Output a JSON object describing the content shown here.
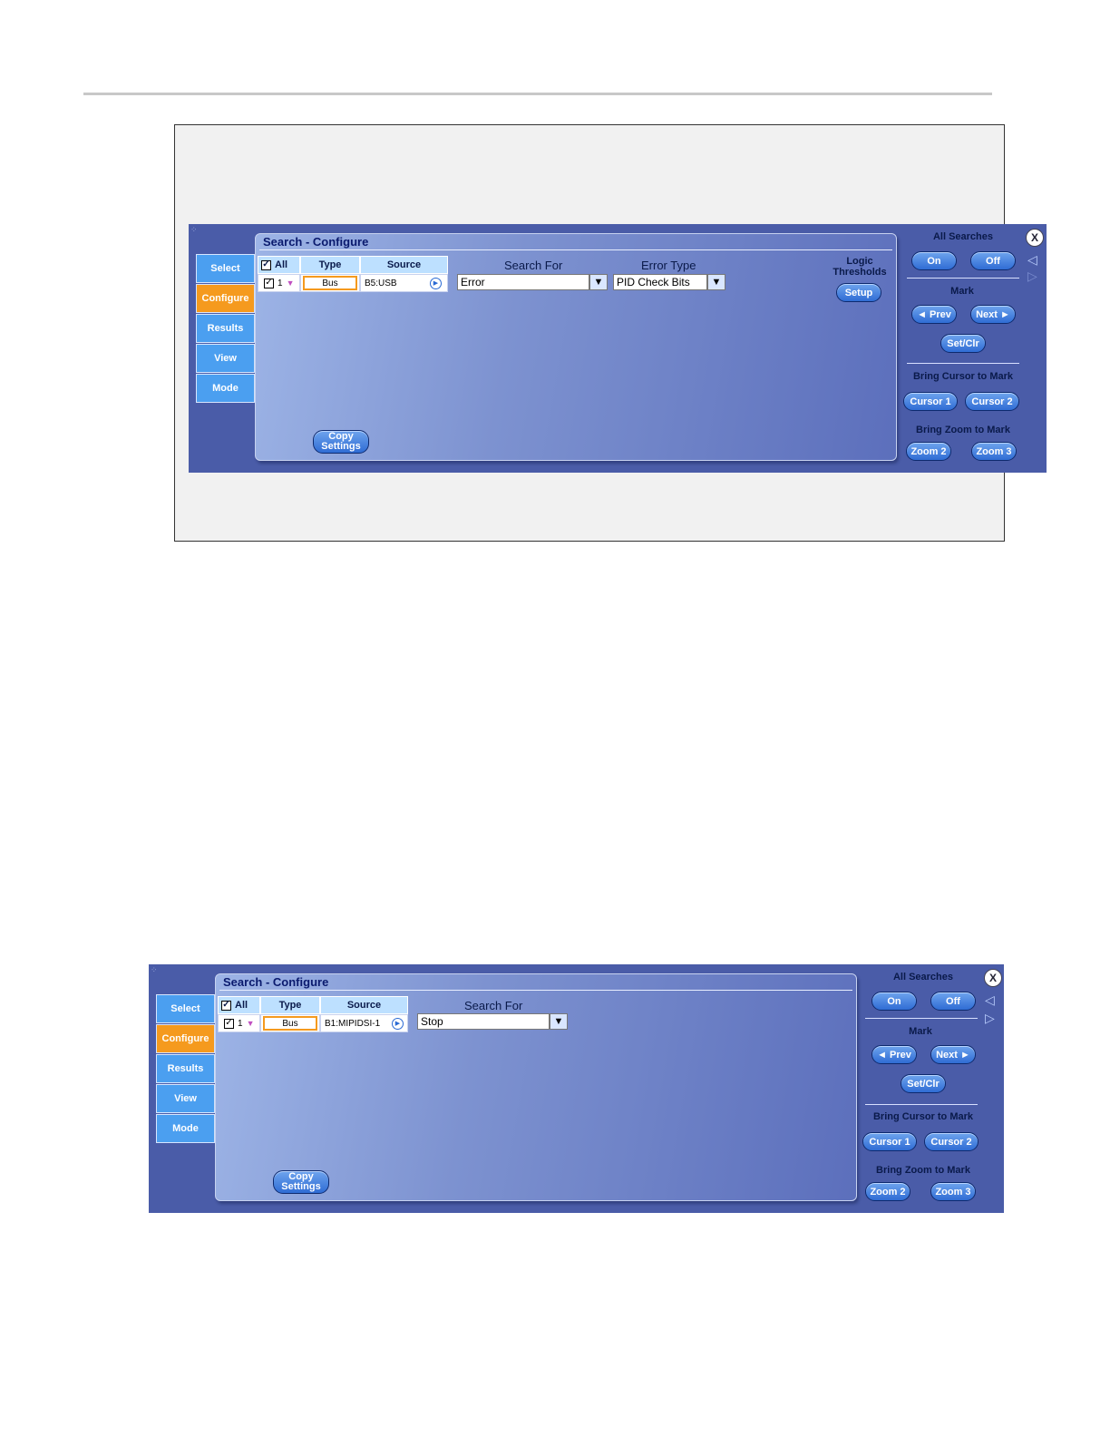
{
  "panel1": {
    "title": "Search - Configure",
    "tabs": [
      "Select",
      "Configure",
      "Results",
      "View",
      "Mode"
    ],
    "active_tab": "Configure",
    "table": {
      "headers": [
        "All",
        "Type",
        "Source"
      ],
      "row": {
        "index": "1",
        "type": "Bus",
        "source": "B5:USB"
      }
    },
    "search_for_label": "Search For",
    "search_for_value": "Error",
    "error_type_label": "Error Type",
    "error_type_value": "PID Check Bits",
    "logic_thresholds_label": "Logic Thresholds",
    "setup_label": "Setup",
    "copy_settings_line1": "Copy",
    "copy_settings_line2": "Settings"
  },
  "panel2": {
    "title": "Search - Configure",
    "tabs": [
      "Select",
      "Configure",
      "Results",
      "View",
      "Mode"
    ],
    "active_tab": "Configure",
    "table": {
      "headers": [
        "All",
        "Type",
        "Source"
      ],
      "row": {
        "index": "1",
        "type": "Bus",
        "source": "B1:MIPIDSI-1"
      }
    },
    "search_for_label": "Search For",
    "search_for_value": "Stop",
    "copy_settings_line1": "Copy",
    "copy_settings_line2": "Settings"
  },
  "side": {
    "all_searches": "All Searches",
    "on": "On",
    "off": "Off",
    "mark": "Mark",
    "prev": "◄ Prev",
    "next": "Next ►",
    "setclr": "Set/Clr",
    "bring_cursor": "Bring Cursor to Mark",
    "cursor1": "Cursor 1",
    "cursor2": "Cursor 2",
    "bring_zoom": "Bring Zoom to Mark",
    "zoom2": "Zoom 2",
    "zoom3": "Zoom 3",
    "close": "X"
  },
  "colors": {
    "panel_bg": "#4a5ca8",
    "tab": "#4b9ff0",
    "tab_active": "#f59a1e",
    "title": "#0a1a6e"
  }
}
